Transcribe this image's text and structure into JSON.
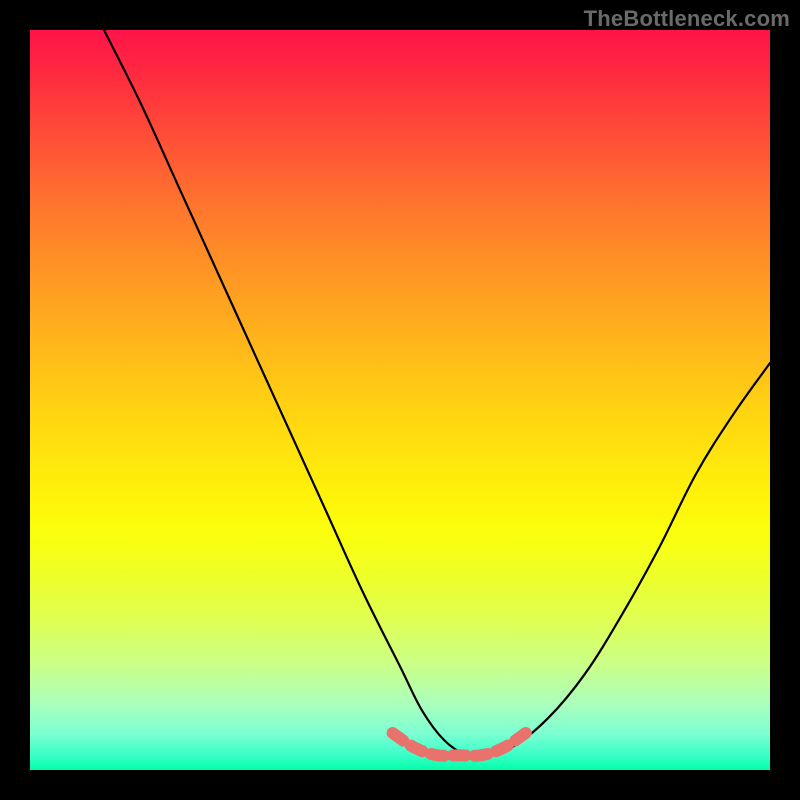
{
  "watermark": "TheBottleneck.com",
  "chart_data": {
    "type": "line",
    "title": "",
    "xlabel": "",
    "ylabel": "",
    "xlim": [
      0,
      100
    ],
    "ylim": [
      0,
      100
    ],
    "grid": false,
    "legend": false,
    "series": [
      {
        "name": "black-curve",
        "x": [
          10,
          15,
          20,
          25,
          30,
          35,
          40,
          45,
          50,
          53,
          56,
          59,
          61,
          65,
          70,
          75,
          80,
          85,
          90,
          95,
          100
        ],
        "y": [
          100,
          90,
          79,
          68,
          57,
          46,
          35,
          24,
          14,
          8,
          4,
          2,
          2,
          3,
          7,
          13,
          21,
          30,
          40,
          48,
          55
        ]
      },
      {
        "name": "pink-dashed-segment",
        "x": [
          49,
          52,
          55,
          58,
          61,
          64,
          67
        ],
        "y": [
          5,
          3,
          2,
          2,
          2,
          3,
          5
        ]
      }
    ],
    "background_gradient": {
      "top": "#ff1449",
      "bottom": "#00ffa8"
    }
  }
}
